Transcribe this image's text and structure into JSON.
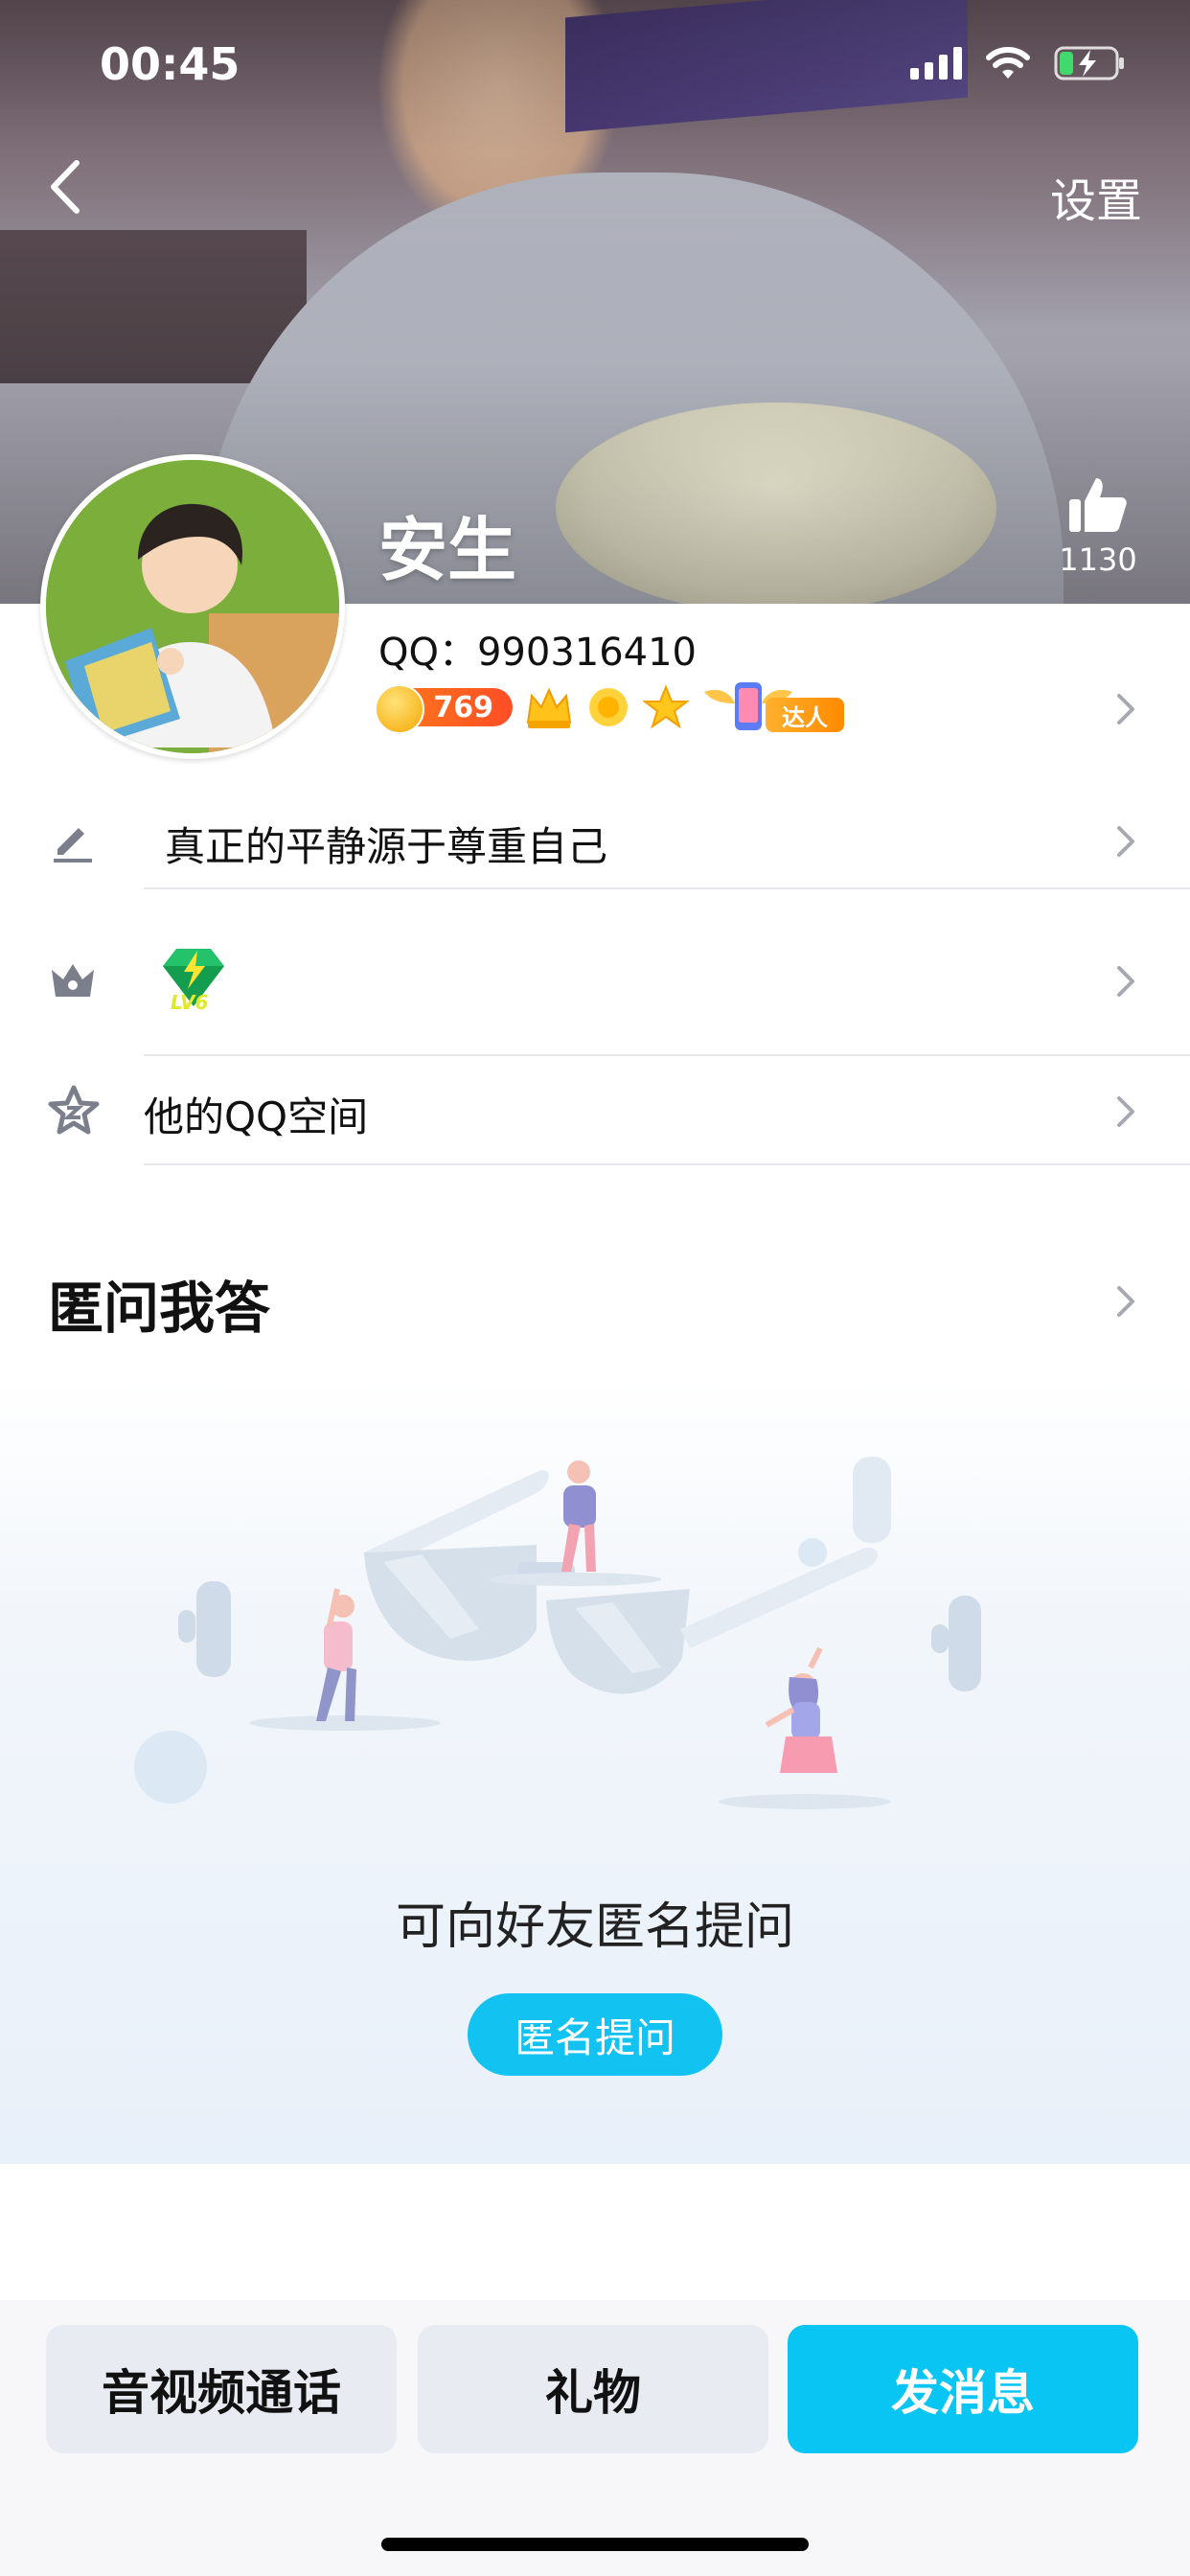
{
  "status_bar": {
    "time": "00:45"
  },
  "header": {
    "settings_label": "设置"
  },
  "profile": {
    "nickname": "安生",
    "qq_line": "QQ：990316410",
    "like_count": "1130",
    "coin_level": "769",
    "daren_tag": "达人"
  },
  "rows": [
    {
      "icon": "pencil-icon",
      "text": "真正的平静源于尊重自己"
    },
    {
      "icon": "vip-crown-icon",
      "text": "",
      "badge_level": "LV6"
    },
    {
      "icon": "qzone-star-icon",
      "text": "他的QQ空间"
    }
  ],
  "qa": {
    "title": "匿问我答",
    "prompt": "可向好友匿名提问",
    "button": "匿名提问"
  },
  "actions": {
    "call": "音视频通话",
    "gift": "礼物",
    "message": "发消息"
  },
  "colors": {
    "accent": "#08c5f3",
    "button_gray": "#e8ebf2",
    "coin_orange": "#ff5a24"
  }
}
